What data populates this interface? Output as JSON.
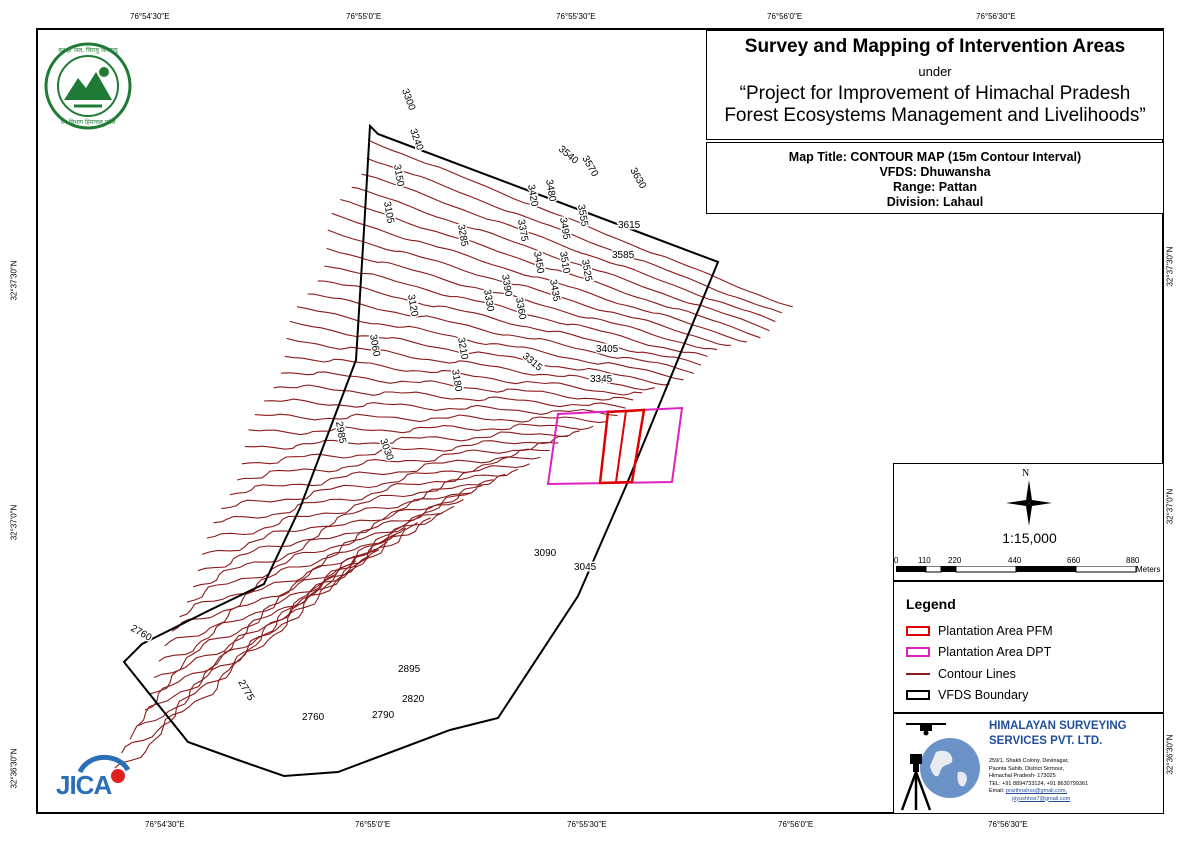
{
  "title": {
    "main": "Survey and Mapping of Intervention Areas",
    "under": "under",
    "project_line1": "“Project for Improvement of Himachal Pradesh",
    "project_line2": "Forest Ecosystems Management and Livelihoods”"
  },
  "info": {
    "map_title": "Map Title: CONTOUR MAP (15m Contour Interval)",
    "vfds": "VFDS: Dhuwansha",
    "range": "Range: Pattan",
    "division": "Division: Lahaul"
  },
  "coords": {
    "lon_ticks": [
      "76°54'30\"E",
      "76°55'0\"E",
      "76°55'30\"E",
      "76°56'0\"E",
      "76°56'30\"E"
    ],
    "lat_ticks": [
      "32°37'30\"N",
      "32°37'0\"N",
      "32°36'30\"N"
    ]
  },
  "scale": {
    "north": "N",
    "ratio": "1:15,000",
    "ticks": [
      "0",
      "110",
      "220",
      "440",
      "660",
      "880"
    ],
    "unit": "Meters"
  },
  "legend": {
    "title": "Legend",
    "items": [
      {
        "label": "Plantation Area PFM",
        "color": "#e00000",
        "kind": "box"
      },
      {
        "label": "Plantation Area DPT",
        "color": "#e020c0",
        "kind": "box"
      },
      {
        "label": "Contour Lines",
        "color": "#8b1a1a",
        "kind": "line"
      },
      {
        "label": "VFDS Boundary",
        "color": "#000000",
        "kind": "box"
      }
    ]
  },
  "company": {
    "name_line1": "HIMALAYAN SURVEYING",
    "name_line2": "SERVICES PVT. LTD.",
    "address": [
      "259/1, Shakti Colony, Devinagar,",
      "Paonta Sahib, District Sirmour,",
      "Himachal Pradesh- 173025"
    ],
    "tel": "TEL: +91 8894733124, +91 8630799361",
    "email_label": "Email:",
    "emails": [
      "prarthnahss@gmail.com,",
      "piyushhss7@gmail.com"
    ],
    "color": "#1f4e9a"
  },
  "contour_labels": [
    "3300",
    "3240",
    "3150",
    "3105",
    "3285",
    "3420",
    "3540",
    "3570",
    "3630",
    "3480",
    "3375",
    "3495",
    "3555",
    "3615",
    "3450",
    "3510",
    "3525",
    "3585",
    "3435",
    "3390",
    "3330",
    "3360",
    "3120",
    "3060",
    "3210",
    "3180",
    "3405",
    "3315",
    "3345",
    "2985",
    "3030",
    "3090",
    "3045",
    "2760",
    "2775",
    "2895",
    "2820",
    "2790",
    "2760"
  ],
  "logos": {
    "hp_forest_text_top": "वन ही जल, चिरायु जलवायु",
    "hp_forest_text_bottom": "वन विभाग हिमाचल प्रदेश",
    "jica": "JICA"
  },
  "colors": {
    "contour": "#8b1a1a",
    "pfm": "#e00000",
    "dpt": "#e020c0",
    "forest_green": "#1e7a34"
  }
}
